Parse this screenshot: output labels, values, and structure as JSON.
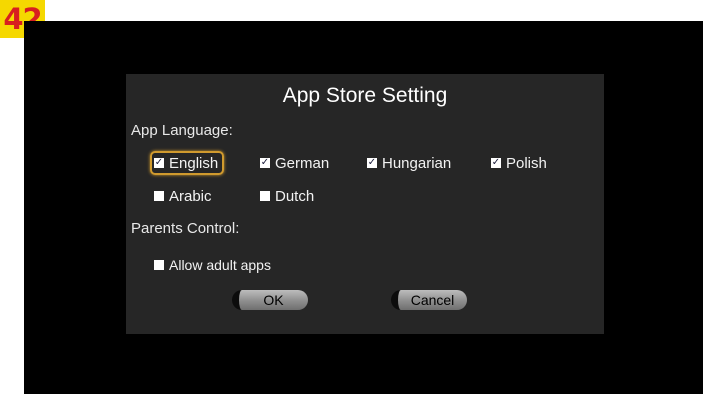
{
  "page_number": "42",
  "dialog": {
    "title": "App Store Setting",
    "app_language_label": "App Language:",
    "languages": [
      {
        "label": "English",
        "checked": true,
        "focused": true
      },
      {
        "label": "German",
        "checked": true,
        "focused": false
      },
      {
        "label": "Hungarian",
        "checked": true,
        "focused": false
      },
      {
        "label": "Polish",
        "checked": true,
        "focused": false
      },
      {
        "label": "Arabic",
        "checked": false,
        "focused": false
      },
      {
        "label": "Dutch",
        "checked": false,
        "focused": false
      }
    ],
    "parents_control_label": "Parents Control:",
    "allow_adult": {
      "label": "Allow adult apps",
      "checked": false
    },
    "ok_label": "OK",
    "cancel_label": "Cancel"
  },
  "colors": {
    "focus_ring": "#d09a2e",
    "dialog_bg": "#262626",
    "screen_bg": "#000000",
    "badge_bg": "#f5d800",
    "badge_text": "#d81f1f"
  }
}
